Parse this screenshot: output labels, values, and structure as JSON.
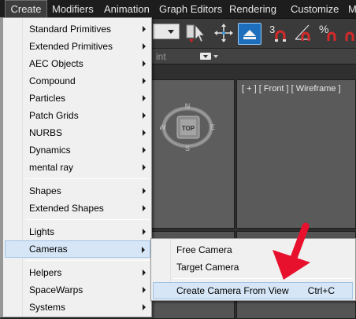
{
  "menubar": {
    "items": [
      "Create",
      "Modifiers",
      "Animation",
      "Graph Editors",
      "Rendering",
      "Customize",
      "M"
    ],
    "active": "Create"
  },
  "toolbar": {
    "snap_label": "3",
    "percent_label": "%"
  },
  "ribbon": {
    "partial_text": "int"
  },
  "viewports": {
    "front_label": "[ + ] [ Front ] [ Wireframe ]",
    "viewcube_label": "TOP",
    "compass": {
      "n": "N",
      "s": "S",
      "e": "E",
      "w": "W"
    }
  },
  "create_menu": {
    "items": [
      {
        "label": "Standard Primitives",
        "submenu": true
      },
      {
        "label": "Extended Primitives",
        "submenu": true
      },
      {
        "label": "AEC Objects",
        "submenu": true
      },
      {
        "label": "Compound",
        "submenu": true
      },
      {
        "label": "Particles",
        "submenu": true
      },
      {
        "label": "Patch Grids",
        "submenu": true
      },
      {
        "label": "NURBS",
        "submenu": true
      },
      {
        "label": "Dynamics",
        "submenu": true
      },
      {
        "label": "mental ray",
        "submenu": true
      },
      {
        "label": "Shapes",
        "submenu": true
      },
      {
        "label": "Extended Shapes",
        "submenu": true
      },
      {
        "label": "Lights",
        "submenu": true
      },
      {
        "label": "Cameras",
        "submenu": true,
        "highlighted": true
      },
      {
        "label": "Helpers",
        "submenu": true
      },
      {
        "label": "SpaceWarps",
        "submenu": true
      },
      {
        "label": "Systems",
        "submenu": true
      }
    ]
  },
  "cameras_submenu": {
    "items": [
      {
        "label": "Free Camera",
        "shortcut": ""
      },
      {
        "label": "Target Camera",
        "shortcut": ""
      },
      {
        "label": "Create Camera From View",
        "shortcut": "Ctrl+C",
        "highlighted": true
      }
    ]
  },
  "colors": {
    "menubar_bg": "#1d1d1d",
    "menu_bg": "#f0f0f0",
    "highlight_bg": "#d6e6f6",
    "highlight_border": "#9fc3e6",
    "accent_blue": "#1d6fbd",
    "annotation_red": "#e8112d"
  }
}
